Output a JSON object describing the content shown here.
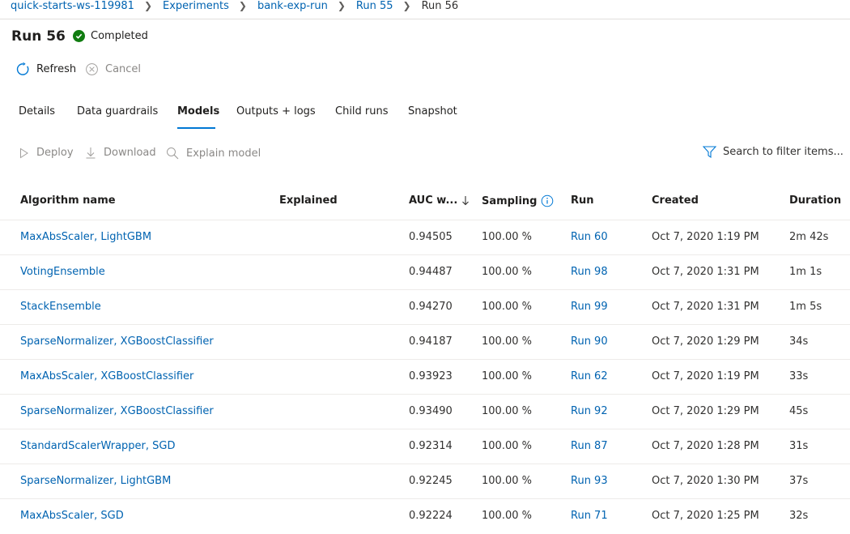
{
  "breadcrumb": {
    "items": [
      "quick-starts-ws-119981",
      "Experiments",
      "bank-exp-run",
      "Run 55"
    ],
    "current": "Run 56"
  },
  "page": {
    "title": "Run 56",
    "status": "Completed",
    "status_color": "#107c10"
  },
  "actions": {
    "refresh": "Refresh",
    "cancel": "Cancel"
  },
  "tabs": [
    {
      "label": "Details"
    },
    {
      "label": "Data guardrails"
    },
    {
      "label": "Models",
      "active": true
    },
    {
      "label": "Outputs + logs"
    },
    {
      "label": "Child runs"
    },
    {
      "label": "Snapshot"
    }
  ],
  "toolbar": {
    "deploy": "Deploy",
    "download": "Download",
    "explain": "Explain model",
    "search_placeholder": "Search to filter items..."
  },
  "table": {
    "headers": {
      "algorithm": "Algorithm name",
      "explained": "Explained",
      "auc": "AUC w...",
      "sampling": "Sampling",
      "run": "Run",
      "created": "Created",
      "duration": "Duration"
    },
    "rows": [
      {
        "algorithm": "MaxAbsScaler, LightGBM",
        "explained": "",
        "auc": "0.94505",
        "sampling": "100.00 %",
        "run": "Run 60",
        "created": "Oct 7, 2020 1:19 PM",
        "duration": "2m 42s"
      },
      {
        "algorithm": "VotingEnsemble",
        "explained": "",
        "auc": "0.94487",
        "sampling": "100.00 %",
        "run": "Run 98",
        "created": "Oct 7, 2020 1:31 PM",
        "duration": "1m 1s"
      },
      {
        "algorithm": "StackEnsemble",
        "explained": "",
        "auc": "0.94270",
        "sampling": "100.00 %",
        "run": "Run 99",
        "created": "Oct 7, 2020 1:31 PM",
        "duration": "1m 5s"
      },
      {
        "algorithm": "SparseNormalizer, XGBoostClassifier",
        "explained": "",
        "auc": "0.94187",
        "sampling": "100.00 %",
        "run": "Run 90",
        "created": "Oct 7, 2020 1:29 PM",
        "duration": "34s"
      },
      {
        "algorithm": "MaxAbsScaler, XGBoostClassifier",
        "explained": "",
        "auc": "0.93923",
        "sampling": "100.00 %",
        "run": "Run 62",
        "created": "Oct 7, 2020 1:19 PM",
        "duration": "33s"
      },
      {
        "algorithm": "SparseNormalizer, XGBoostClassifier",
        "explained": "",
        "auc": "0.93490",
        "sampling": "100.00 %",
        "run": "Run 92",
        "created": "Oct 7, 2020 1:29 PM",
        "duration": "45s"
      },
      {
        "algorithm": "StandardScalerWrapper, SGD",
        "explained": "",
        "auc": "0.92314",
        "sampling": "100.00 %",
        "run": "Run 87",
        "created": "Oct 7, 2020 1:28 PM",
        "duration": "31s"
      },
      {
        "algorithm": "SparseNormalizer, LightGBM",
        "explained": "",
        "auc": "0.92245",
        "sampling": "100.00 %",
        "run": "Run 93",
        "created": "Oct 7, 2020 1:30 PM",
        "duration": "37s"
      },
      {
        "algorithm": "MaxAbsScaler, SGD",
        "explained": "",
        "auc": "0.92224",
        "sampling": "100.00 %",
        "run": "Run 71",
        "created": "Oct 7, 2020 1:25 PM",
        "duration": "32s"
      }
    ]
  }
}
